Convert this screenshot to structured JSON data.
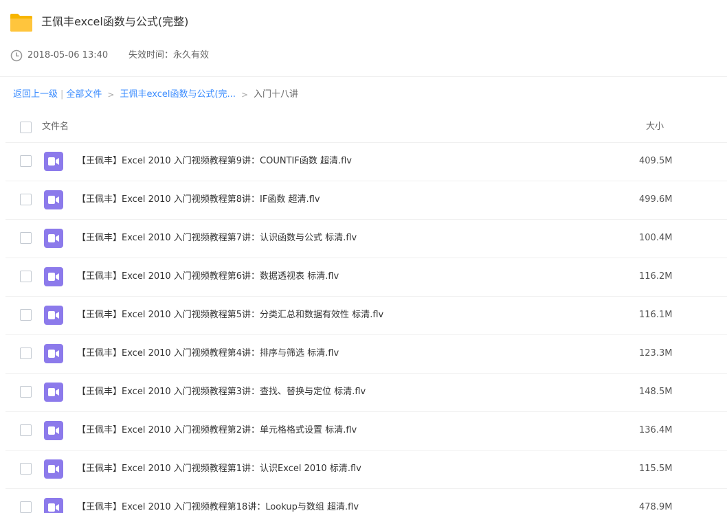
{
  "header": {
    "title": "王佩丰excel函数与公式(完整)",
    "date": "2018-05-06 13:40",
    "expire": "失效时间：永久有效"
  },
  "breadcrumb": {
    "back": "返回上一级",
    "all_files": "全部文件",
    "parent": "王佩丰excel函数与公式(完...",
    "current": "入门十八讲",
    "separator": ">"
  },
  "list": {
    "col_name": "文件名",
    "col_size": "大小",
    "files": [
      {
        "name": "【王佩丰】Excel 2010 入门视频教程第9讲：COUNTIF函数 超清.flv",
        "size": "409.5M"
      },
      {
        "name": "【王佩丰】Excel 2010 入门视频教程第8讲：IF函数 超清.flv",
        "size": "499.6M"
      },
      {
        "name": "【王佩丰】Excel 2010 入门视频教程第7讲：认识函数与公式 标清.flv",
        "size": "100.4M"
      },
      {
        "name": "【王佩丰】Excel 2010 入门视频教程第6讲：数据透视表 标清.flv",
        "size": "116.2M"
      },
      {
        "name": "【王佩丰】Excel 2010 入门视频教程第5讲：分类汇总和数据有效性 标清.flv",
        "size": "116.1M"
      },
      {
        "name": "【王佩丰】Excel 2010 入门视频教程第4讲：排序与筛选 标清.flv",
        "size": "123.3M"
      },
      {
        "name": "【王佩丰】Excel 2010 入门视频教程第3讲：查找、替换与定位 标清.flv",
        "size": "148.5M"
      },
      {
        "name": "【王佩丰】Excel 2010 入门视频教程第2讲：单元格格式设置 标清.flv",
        "size": "136.4M"
      },
      {
        "name": "【王佩丰】Excel 2010 入门视频教程第1讲：认识Excel 2010 标清.flv",
        "size": "115.5M"
      },
      {
        "name": "【王佩丰】Excel 2010 入门视频教程第18讲：Lookup与数组 超清.flv",
        "size": "478.9M"
      }
    ]
  },
  "colors": {
    "link": "#3b8cff",
    "folder": "#ffc53d",
    "video_icon": "#8c7aeb"
  }
}
